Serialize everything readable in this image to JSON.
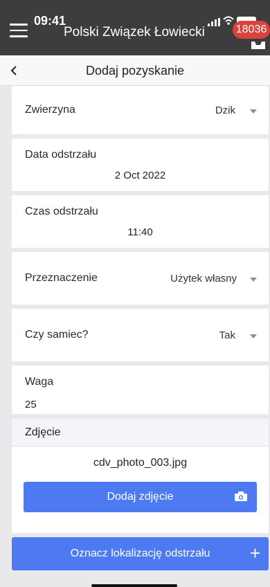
{
  "status": {
    "time": "09:41",
    "badge": "18036"
  },
  "app": {
    "title": "Polski Związek Łowiecki"
  },
  "nav": {
    "title": "Dodaj pozyskanie"
  },
  "form": {
    "species": {
      "label": "Zwierzyna",
      "value": "Dzik"
    },
    "date": {
      "label": "Data odstrzału",
      "value": "2 Oct 2022"
    },
    "time": {
      "label": "Czas odstrzału",
      "value": "11:40"
    },
    "purpose": {
      "label": "Przeznaczenie",
      "value": "Użytek własny"
    },
    "male": {
      "label": "Czy samiec?",
      "value": "Tak"
    },
    "weight": {
      "label": "Waga",
      "value": "25"
    }
  },
  "photo": {
    "header": "Zdjęcie",
    "filename": "cdv_photo_003.jpg",
    "add_button": "Dodaj zdjęcie"
  },
  "location_button": "Oznacz lokalizację odstrzału",
  "colors": {
    "topbar": "#3d3d3d",
    "accent": "#4d7af0",
    "badge": "#d9433b"
  },
  "icons": [
    "menu-icon",
    "signal-icon",
    "wifi-icon",
    "battery-icon",
    "tray-icon",
    "back-icon",
    "caret-icon",
    "camera-icon",
    "plus-icon"
  ]
}
